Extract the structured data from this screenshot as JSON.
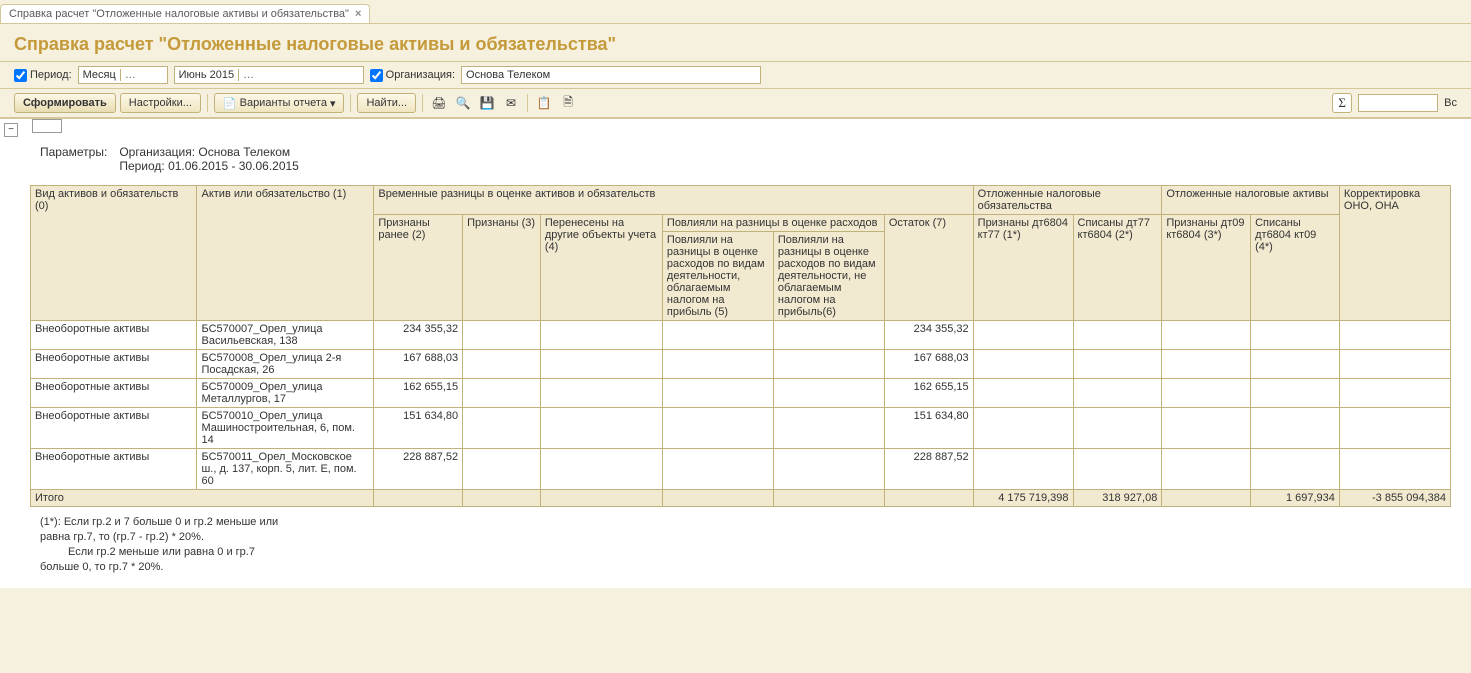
{
  "tab": {
    "title": "Справка расчет \"Отложенные налоговые активы и обязательства\""
  },
  "page_title": "Справка расчет \"Отложенные налоговые активы и обязательства\"",
  "filters": {
    "period_label": "Период:",
    "period_type": "Месяц",
    "period_value": "Июнь 2015",
    "org_label": "Организация:",
    "org_value": "Основа Телеком"
  },
  "toolbar": {
    "generate": "Сформировать",
    "settings": "Настройки...",
    "variants": "Варианты отчета",
    "find": "Найти...",
    "all": "Вс"
  },
  "params": {
    "heading": "Параметры:",
    "org_line": "Организация: Основа Телеком",
    "period_line": "Период: 01.06.2015 - 30.06.2015"
  },
  "headers": {
    "c0": "Вид активов и обязательств (0)",
    "c1": "Актив или обязательство (1)",
    "g_diff": "Временные разницы в оценке активов и обязательств",
    "c2": "Признаны ранее (2)",
    "c3": "Признаны (3)",
    "c4": "Перенесены на другие объекты учета (4)",
    "g_exp": "Повлияли на разницы в оценке расходов",
    "c5": "Повлияли на разницы в оценке расходов по видам деятельности, облагаемым налогом на прибыль (5)",
    "c6": "Повлияли на разницы в оценке расходов по видам деятельности, не облагаемым налогом на прибыль(6)",
    "c7": "Остаток (7)",
    "g_liab": "Отложенные налоговые обязательства",
    "c1s": "Признаны дт6804 кт77 (1*)",
    "c2s": "Списаны дт77 кт6804 (2*)",
    "g_asset": "Отложенные налоговые активы",
    "c3s": "Признаны дт09 кт6804 (3*)",
    "c4s": "Списаны дт6804 кт09 (4*)",
    "c_corr": "Корректировка ОНО, ОНА"
  },
  "rows": [
    {
      "type": "Внеоборотные активы",
      "asset": "БС570007_Орел_улица Васильевская, 138",
      "c2": "234 355,32",
      "c7": "234 355,32"
    },
    {
      "type": "Внеоборотные активы",
      "asset": "БС570008_Орел_улица 2-я Посадская, 26",
      "c2": "167 688,03",
      "c7": "167 688,03"
    },
    {
      "type": "Внеоборотные активы",
      "asset": "БС570009_Орел_улица Металлургов, 17",
      "c2": "162 655,15",
      "c7": "162 655,15"
    },
    {
      "type": "Внеоборотные активы",
      "asset": "БС570010_Орел_улица Машиностроительная, 6, пом. 14",
      "c2": "151 634,80",
      "c7": "151 634,80"
    },
    {
      "type": "Внеоборотные активы",
      "asset": "БС570011_Орел_Московское ш., д. 137, корп. 5, лит. Е, пом. 60",
      "c2": "228 887,52",
      "c7": "228 887,52"
    }
  ],
  "totals": {
    "label": "Итого",
    "c1s": "4 175 719,398",
    "c2s": "318 927,08",
    "c4s": "1 697,934",
    "corr": "-3 855 094,384"
  },
  "footnotes": {
    "l1": "(1*): Если гр.2 и 7 больше 0 и гр.2 меньше или",
    "l2": "равна гр.7, то (гр.7 - гр.2) * 20%.",
    "l3": "Если гр.2 меньше или равна 0 и гр.7",
    "l4": "больше 0, то   гр.7 * 20%."
  }
}
